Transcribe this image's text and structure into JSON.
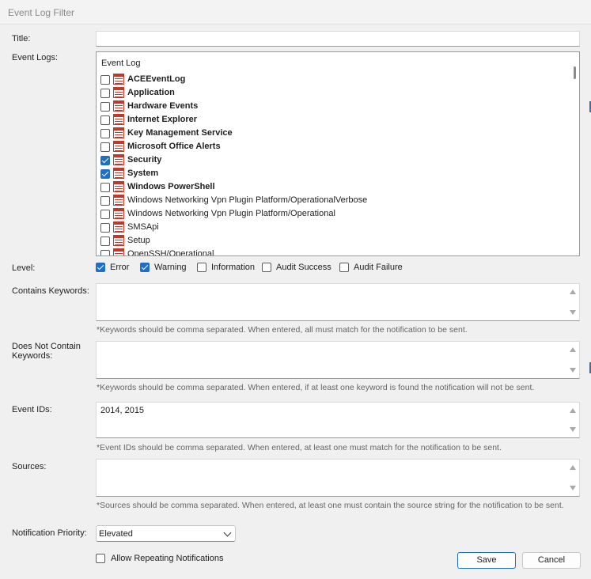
{
  "window": {
    "title": "Event Log Filter"
  },
  "labels": {
    "title": "Title:",
    "event_logs": "Event Logs:",
    "level": "Level:",
    "contains_keywords": "Contains Keywords:",
    "does_not_contain_line1": "Does Not Contain",
    "does_not_contain_line2": "Keywords:",
    "event_ids": "Event IDs:",
    "sources": "Sources:",
    "notification_priority": "Notification Priority:"
  },
  "fields": {
    "title_value": "",
    "contains_keywords_value": "",
    "does_not_contain_value": "",
    "event_ids_value": "2014, 2015",
    "sources_value": ""
  },
  "hints": {
    "contains_keywords": "*Keywords should be comma separated. When entered, all must match for the notification to be sent.",
    "does_not_contain": "*Keywords should be comma separated. When entered, if at least one keyword is found the notification will not be sent.",
    "event_ids": "*Event IDs should be comma separated. When entered, at least one must match for the notification to be sent.",
    "sources": "*Sources should be comma separated. When entered, at least one must contain the source string for the notification to be sent."
  },
  "event_log_list": {
    "header": "Event Log",
    "items": [
      {
        "name": "ACEEventLog",
        "checked": false,
        "bold": true
      },
      {
        "name": "Application",
        "checked": false,
        "bold": true
      },
      {
        "name": "Hardware Events",
        "checked": false,
        "bold": true
      },
      {
        "name": "Internet Explorer",
        "checked": false,
        "bold": true
      },
      {
        "name": "Key Management Service",
        "checked": false,
        "bold": true
      },
      {
        "name": "Microsoft Office Alerts",
        "checked": false,
        "bold": true
      },
      {
        "name": "Security",
        "checked": true,
        "bold": true
      },
      {
        "name": "System",
        "checked": true,
        "bold": true
      },
      {
        "name": "Windows PowerShell",
        "checked": false,
        "bold": true
      },
      {
        "name": "Windows Networking Vpn Plugin Platform/OperationalVerbose",
        "checked": false,
        "bold": false
      },
      {
        "name": "Windows Networking Vpn Plugin Platform/Operational",
        "checked": false,
        "bold": false
      },
      {
        "name": "SMSApi",
        "checked": false,
        "bold": false
      },
      {
        "name": "Setup",
        "checked": false,
        "bold": false
      },
      {
        "name": "OpenSSH/Operational",
        "checked": false,
        "bold": false
      }
    ]
  },
  "levels": [
    {
      "label": "Error",
      "checked": true
    },
    {
      "label": "Warning",
      "checked": true
    },
    {
      "label": "Information",
      "checked": false
    },
    {
      "label": "Audit Success",
      "checked": false
    },
    {
      "label": "Audit Failure",
      "checked": false
    }
  ],
  "priority": {
    "selected": "Elevated"
  },
  "repeat": {
    "label": "Allow Repeating Notifications",
    "checked": false
  },
  "buttons": {
    "save": "Save",
    "cancel": "Cancel"
  },
  "colors": {
    "accent": "#1f6fc5",
    "log_icon": "#c0392b",
    "window_bg": "#f0f0f0"
  }
}
